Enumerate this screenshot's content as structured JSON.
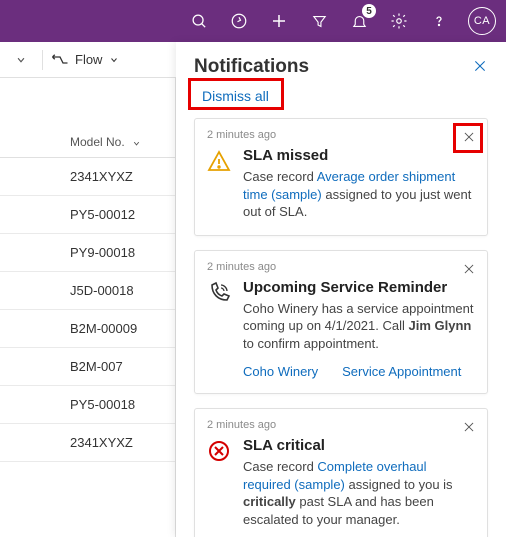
{
  "topbar": {
    "badge_count": "5",
    "avatar_initials": "CA"
  },
  "subbar": {
    "flow_label": "Flow"
  },
  "table": {
    "col_header": "Model No.",
    "rows": [
      "2341XYXZ",
      "PY5-00012",
      "PY9-00018",
      "J5D-00018",
      "B2M-00009",
      "B2M-007",
      "PY5-00018",
      "2341XYXZ"
    ]
  },
  "notifications": {
    "title": "Notifications",
    "dismiss_all": "Dismiss all",
    "cards": [
      {
        "time": "2 minutes ago",
        "title": "SLA missed",
        "text_pre": "Case record ",
        "link": "Average order shipment time (sample)",
        "text_post": " assigned to you just went out of SLA."
      },
      {
        "time": "2 minutes ago",
        "title": "Upcoming Service Reminder",
        "text_pre": "Coho Winery has a service appointment coming up on 4/1/2021. Call ",
        "bold": "Jim Glynn",
        "text_post": " to confirm appointment.",
        "action1": "Coho Winery",
        "action2": "Service Appointment"
      },
      {
        "time": "2 minutes ago",
        "title": "SLA critical",
        "text_pre": "Case record ",
        "link": "Complete overhaul required (sample)",
        "text_mid": " assigned to you is ",
        "bold": "critically",
        "text_post": " past SLA and has been escalated to your manager."
      }
    ]
  }
}
